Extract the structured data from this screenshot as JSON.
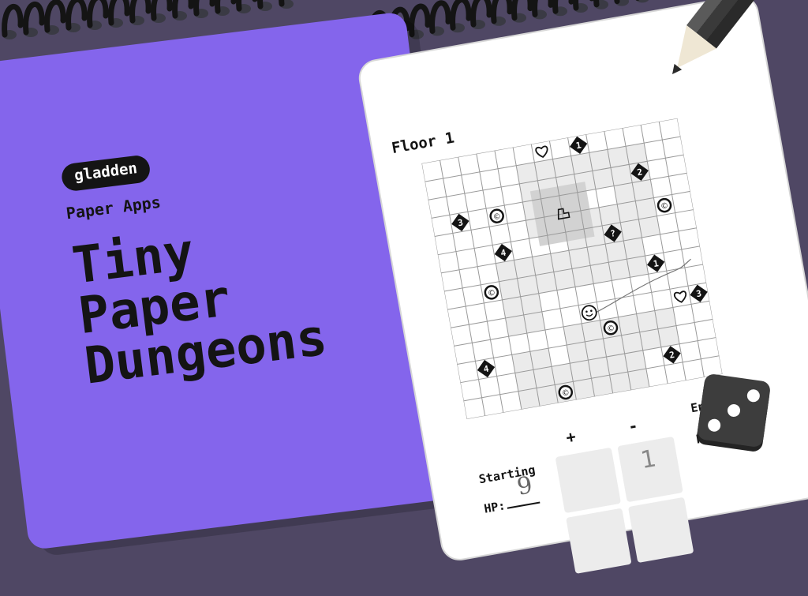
{
  "cover": {
    "brand": "gladden",
    "subtitle": "Paper Apps",
    "title_lines": [
      "Tiny",
      "Paper",
      "Dungeons"
    ]
  },
  "sheet": {
    "floor_label": "Floor 1",
    "starting_label": "Starting",
    "ending_label": "Ending",
    "plus_label": "+",
    "minus_label": "-",
    "hp_label": "HP:",
    "starting_hp_value": "9",
    "plus_box_value": "",
    "minus_box_value": "1"
  },
  "colors": {
    "background": "#4f4764",
    "cover": "#8465ec",
    "ink": "#141414"
  },
  "icons": [
    "spiral-binding-icon",
    "heart-icon",
    "coin-icon",
    "smiley-icon",
    "stairs-icon",
    "diamond-number-icon",
    "pencil-icon",
    "die-icon"
  ],
  "map_markers": [
    {
      "type": "diamond",
      "text": "1"
    },
    {
      "type": "diamond",
      "text": "2"
    },
    {
      "type": "diamond",
      "text": "3"
    },
    {
      "type": "diamond",
      "text": "4"
    },
    {
      "type": "diamond",
      "text": "?"
    },
    {
      "type": "diamond",
      "text": "1"
    },
    {
      "type": "diamond",
      "text": "3"
    },
    {
      "type": "diamond",
      "text": "4"
    },
    {
      "type": "diamond",
      "text": "2"
    },
    {
      "type": "heart",
      "text": ""
    },
    {
      "type": "heart",
      "text": ""
    },
    {
      "type": "coin",
      "text": "©"
    },
    {
      "type": "coin",
      "text": "©"
    },
    {
      "type": "coin",
      "text": "©"
    },
    {
      "type": "coin",
      "text": "©"
    },
    {
      "type": "coin",
      "text": "©"
    },
    {
      "type": "smiley",
      "text": ""
    }
  ]
}
